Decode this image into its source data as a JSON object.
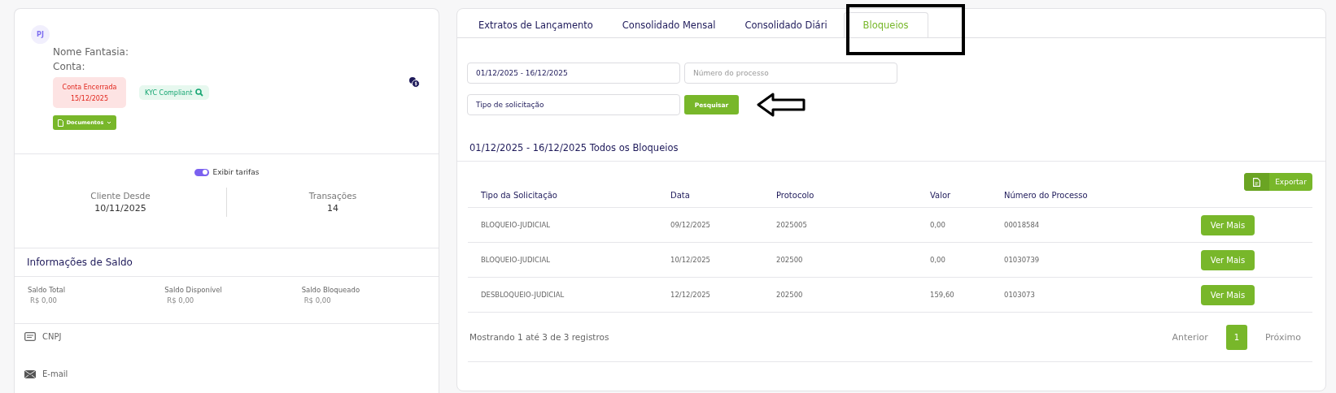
{
  "profile": {
    "avatar": "PJ",
    "fields": [
      "Nome Fantasia:",
      "Conta:"
    ],
    "status_badge": {
      "label": "Conta Encerrada",
      "date": "15/12/2025"
    },
    "kyc_badge": "KYC Compliant",
    "documents_button": "Documentos"
  },
  "fee_toggle": {
    "label": "Exibir tarifas",
    "on": true
  },
  "stats": [
    {
      "label": "Cliente Desde",
      "value": "10/11/2025"
    },
    {
      "label": "Transações",
      "value": "14"
    }
  ],
  "balance": {
    "title": "Informações de Saldo",
    "items": [
      {
        "label": "Saldo Total",
        "value": "R$ 0,00"
      },
      {
        "label": "Saldo Disponível",
        "value": "R$ 0,00"
      },
      {
        "label": "Saldo Bloqueado",
        "value": "R$ 0,00"
      }
    ]
  },
  "contacts": [
    {
      "kind": "document",
      "label": "CNPJ"
    },
    {
      "kind": "email",
      "label": "E-mail"
    }
  ],
  "tabs": [
    {
      "label": "Extratos de Lançamento",
      "selected": false
    },
    {
      "label": "Consolidado Mensal",
      "selected": false
    },
    {
      "label": "Consolidado Diári",
      "selected": false
    },
    {
      "label": "Bloqueios",
      "selected": true
    }
  ],
  "filters": {
    "date_range": "01/12/2025 - 16/12/2025",
    "process_number_placeholder": "Número do processo",
    "request_type": "Tipo de solicitação",
    "search_button": "Pesquisar"
  },
  "results": {
    "title": "01/12/2025 - 16/12/2025 Todos os Bloqueios",
    "export_button": "Exportar",
    "columns": [
      "Tipo da Solicitação",
      "Data",
      "Protocolo",
      "Valor",
      "Número do Processo"
    ],
    "rows": [
      {
        "cells": [
          "BLOQUEIO-JUDICIAL",
          "09/12/2025",
          "2025005",
          "0,00",
          "00018584"
        ],
        "action": "Ver Mais"
      },
      {
        "cells": [
          "BLOQUEIO-JUDICIAL",
          "10/12/2025",
          "202500",
          "0,00",
          "01030739"
        ],
        "action": "Ver Mais"
      },
      {
        "cells": [
          "DESBLOQUEIO-JUDICIAL",
          "12/12/2025",
          "202500",
          "159,60",
          "0103073"
        ],
        "action": "Ver Mais"
      }
    ],
    "summary": "Mostrando 1 até 3 de 3 registros",
    "pagination": {
      "previous": "Anterior",
      "pages": [
        {
          "label": "1",
          "selected": true
        }
      ],
      "next": "Próximo"
    }
  }
}
